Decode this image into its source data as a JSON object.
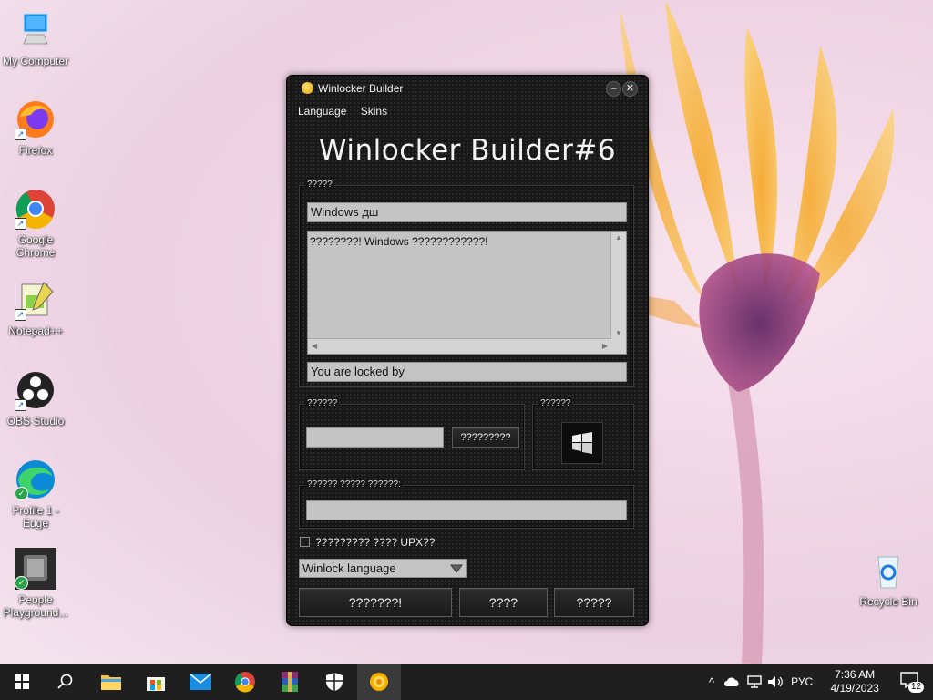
{
  "desktop": {
    "icons": [
      {
        "label": "My Computer"
      },
      {
        "label": "Firefox"
      },
      {
        "label": "Google Chrome"
      },
      {
        "label": "Notepad++"
      },
      {
        "label": "OBS Studio"
      },
      {
        "label": "Profile 1 - Edge"
      },
      {
        "label": "People Playground..."
      },
      {
        "label": "Recycle Bin"
      }
    ]
  },
  "window": {
    "title": "Winlocker Builder",
    "minimize": "–",
    "close": "✕",
    "menu": {
      "language": "Language",
      "skins": "Skins"
    },
    "heading": "Winlocker Builder#6",
    "group1": {
      "legend": "?????",
      "title_value": "Windows дш",
      "message": "????????! Windows ????????????!",
      "locked_by": "You are locked by"
    },
    "group2": {
      "legend": "??????",
      "input_value": "",
      "button": "?????????"
    },
    "group3": {
      "legend": "??????"
    },
    "group4": {
      "legend": "?????? ????? ??????:",
      "input_value": ""
    },
    "upx_checkbox": {
      "label": "????????? ???? UPX??",
      "checked": false
    },
    "language_combo": {
      "value": "Winlock language"
    },
    "buttons": {
      "build": "???????!",
      "b2": "????",
      "b3": "?????"
    }
  },
  "taskbar": {
    "tray": {
      "language": "РУС",
      "time": "7:36 AM",
      "date": "4/19/2023",
      "notifications": "12"
    }
  },
  "colors": {
    "accent": "#e0a400",
    "taskbar": "#1f1f1f",
    "window_bg": "#171717"
  }
}
